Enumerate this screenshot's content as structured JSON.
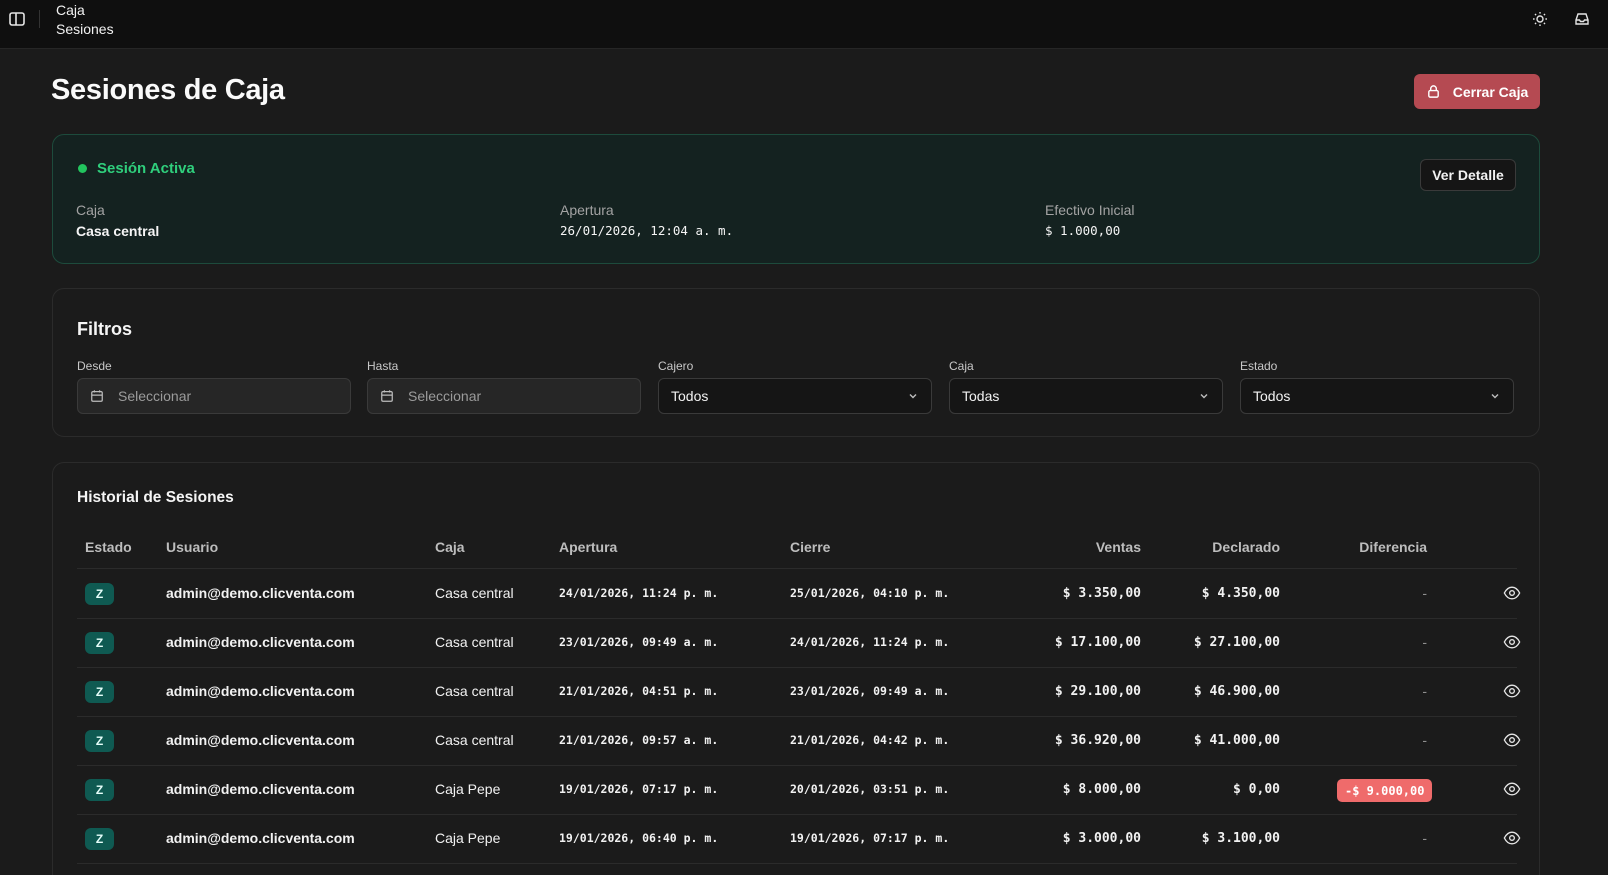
{
  "breadcrumb": [
    "Caja",
    "Sesiones"
  ],
  "page": {
    "title": "Sesiones de Caja",
    "close_button": "Cerrar Caja"
  },
  "active_session": {
    "title": "Sesión Activa",
    "detail_button": "Ver Detalle",
    "fields": [
      {
        "label": "Caja",
        "value": "Casa central"
      },
      {
        "label": "Apertura",
        "value": "26/01/2026, 12:04 a. m."
      },
      {
        "label": "Efectivo Inicial",
        "value": "$ 1.000,00"
      }
    ]
  },
  "filters": {
    "title": "Filtros",
    "desde": {
      "label": "Desde",
      "placeholder": "Seleccionar"
    },
    "hasta": {
      "label": "Hasta",
      "placeholder": "Seleccionar"
    },
    "cajero": {
      "label": "Cajero",
      "value": "Todos"
    },
    "caja": {
      "label": "Caja",
      "value": "Todas"
    },
    "estado": {
      "label": "Estado",
      "value": "Todos"
    }
  },
  "history": {
    "title": "Historial de Sesiones",
    "columns": [
      "Estado",
      "Usuario",
      "Caja",
      "Apertura",
      "Cierre",
      "Ventas",
      "Declarado",
      "Diferencia"
    ],
    "rows": [
      {
        "estado": "Z",
        "usuario": "admin@demo.clicventa.com",
        "caja": "Casa central",
        "apertura": "24/01/2026, 11:24 p. m.",
        "cierre": "25/01/2026, 04:10 p. m.",
        "ventas": "$ 3.350,00",
        "declarado": "$ 4.350,00",
        "diferencia": "-"
      },
      {
        "estado": "Z",
        "usuario": "admin@demo.clicventa.com",
        "caja": "Casa central",
        "apertura": "23/01/2026, 09:49 a. m.",
        "cierre": "24/01/2026, 11:24 p. m.",
        "ventas": "$ 17.100,00",
        "declarado": "$ 27.100,00",
        "diferencia": "-"
      },
      {
        "estado": "Z",
        "usuario": "admin@demo.clicventa.com",
        "caja": "Casa central",
        "apertura": "21/01/2026, 04:51 p. m.",
        "cierre": "23/01/2026, 09:49 a. m.",
        "ventas": "$ 29.100,00",
        "declarado": "$ 46.900,00",
        "diferencia": "-"
      },
      {
        "estado": "Z",
        "usuario": "admin@demo.clicventa.com",
        "caja": "Casa central",
        "apertura": "21/01/2026, 09:57 a. m.",
        "cierre": "21/01/2026, 04:42 p. m.",
        "ventas": "$ 36.920,00",
        "declarado": "$ 41.000,00",
        "diferencia": "-"
      },
      {
        "estado": "Z",
        "usuario": "admin@demo.clicventa.com",
        "caja": "Caja Pepe",
        "apertura": "19/01/2026, 07:17 p. m.",
        "cierre": "20/01/2026, 03:51 p. m.",
        "ventas": "$ 8.000,00",
        "declarado": "$ 0,00",
        "diferencia": "-$ 9.000,00"
      },
      {
        "estado": "Z",
        "usuario": "admin@demo.clicventa.com",
        "caja": "Caja Pepe",
        "apertura": "19/01/2026, 06:40 p. m.",
        "cierre": "19/01/2026, 07:17 p. m.",
        "ventas": "$ 3.000,00",
        "declarado": "$ 3.100,00",
        "diferencia": "-"
      }
    ]
  },
  "colors": {
    "accent_green": "#2fcf7c",
    "danger": "#b54a52",
    "negative_badge": "#ef6b6b",
    "badge_teal": "#0f5a52"
  },
  "icons": [
    "sidebar-toggle-icon",
    "sun-icon",
    "inbox-icon",
    "lock-icon",
    "calendar-icon",
    "chevron-down-icon",
    "eye-icon"
  ]
}
